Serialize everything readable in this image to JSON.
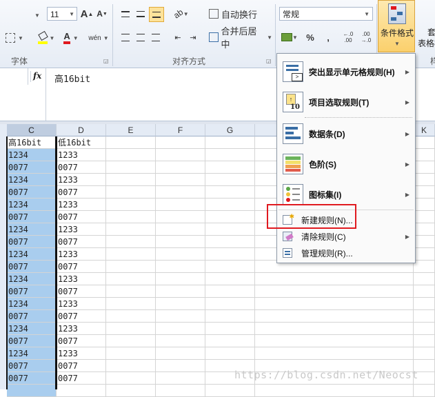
{
  "ribbon": {
    "font_size_value": "11",
    "number_format_value": "常规",
    "wrap_text_label": "自动换行",
    "merge_center_label": "合并后居中",
    "percent_label": "%",
    "comma_label": ",",
    "increase_decimal_label": "←.0 .00",
    "decrease_decimal_label": ".00 →.0",
    "conditional_format_label": "条件格式",
    "table_format_label_1": "套",
    "table_format_label_2": "表格样",
    "group_font_label": "字体",
    "group_align_label": "对齐方式",
    "grow_font_label": "A",
    "shrink_font_label": "A",
    "font_color_label": "A",
    "phonetic_label": "wén",
    "right_cut_label": "样"
  },
  "formula_bar": {
    "fx_label": "fx",
    "content": "高16bit"
  },
  "columns": [
    "C",
    "D",
    "E",
    "F",
    "G",
    "K"
  ],
  "sheet": {
    "rows": [
      [
        "高16bit",
        "低16bit"
      ],
      [
        "1234",
        "1233"
      ],
      [
        "0077",
        "0077"
      ],
      [
        "1234",
        "1233"
      ],
      [
        "0077",
        "0077"
      ],
      [
        "1234",
        "1233"
      ],
      [
        "0077",
        "0077"
      ],
      [
        "1234",
        "1233"
      ],
      [
        "0077",
        "0077"
      ],
      [
        "1234",
        "1233"
      ],
      [
        "0077",
        "0077"
      ],
      [
        "1234",
        "1233"
      ],
      [
        "0077",
        "0077"
      ],
      [
        "1234",
        "1233"
      ],
      [
        "0077",
        "0077"
      ],
      [
        "1234",
        "1233"
      ],
      [
        "0077",
        "0077"
      ],
      [
        "1234",
        "1233"
      ],
      [
        "0077",
        "0077"
      ],
      [
        "0077",
        "0077"
      ]
    ]
  },
  "menu": {
    "items": [
      {
        "label": "突出显示单元格规则(H)",
        "icon": "highlight-cells-rules-icon"
      },
      {
        "label": "项目选取规则(T)",
        "icon": "top-bottom-rules-icon"
      },
      {
        "label": "数据条(D)",
        "icon": "data-bars-icon"
      },
      {
        "label": "色阶(S)",
        "icon": "color-scales-icon"
      },
      {
        "label": "图标集(I)",
        "icon": "icon-sets-icon"
      },
      {
        "label": "新建规则(N)...",
        "icon": "new-rule-icon"
      },
      {
        "label": "清除规则(C)",
        "icon": "clear-rules-icon"
      },
      {
        "label": "管理规则(R)...",
        "icon": "manage-rules-icon"
      }
    ]
  },
  "watermark": "https://blog.csdn.net/Neocst",
  "colors": {
    "selection": "#a9cdee",
    "highlight_box": "#e0191f",
    "ribbon_bg": "#e6ecf5"
  }
}
